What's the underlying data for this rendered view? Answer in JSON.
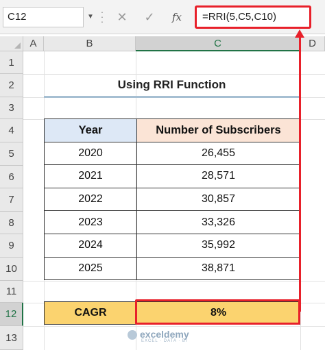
{
  "formula_bar": {
    "name_box": "C12",
    "cancel_icon": "✕",
    "enter_icon": "✓",
    "fx_label": "fx",
    "formula": "=RRI(5,C5,C10)"
  },
  "columns": [
    "A",
    "B",
    "C",
    "D"
  ],
  "rows": [
    "1",
    "2",
    "3",
    "4",
    "5",
    "6",
    "7",
    "8",
    "9",
    "10",
    "11",
    "12",
    "13"
  ],
  "selected_column": "C",
  "selected_row": "12",
  "title": "Using RRI Function",
  "table": {
    "headers": {
      "year": "Year",
      "subscribers": "Number of Subscribers"
    },
    "rows": [
      {
        "year": "2020",
        "subscribers": "26,455"
      },
      {
        "year": "2021",
        "subscribers": "28,571"
      },
      {
        "year": "2022",
        "subscribers": "30,857"
      },
      {
        "year": "2023",
        "subscribers": "33,326"
      },
      {
        "year": "2024",
        "subscribers": "35,992"
      },
      {
        "year": "2025",
        "subscribers": "38,871"
      }
    ]
  },
  "cagr": {
    "label": "CAGR",
    "value": "8%"
  },
  "watermark": {
    "name": "exceldemy",
    "tagline": "EXCEL · DATA · BI"
  },
  "colors": {
    "highlight": "#e8202a",
    "year_header": "#dde8f6",
    "subs_header": "#fbe4d6",
    "cagr_fill": "#fbd36f"
  }
}
